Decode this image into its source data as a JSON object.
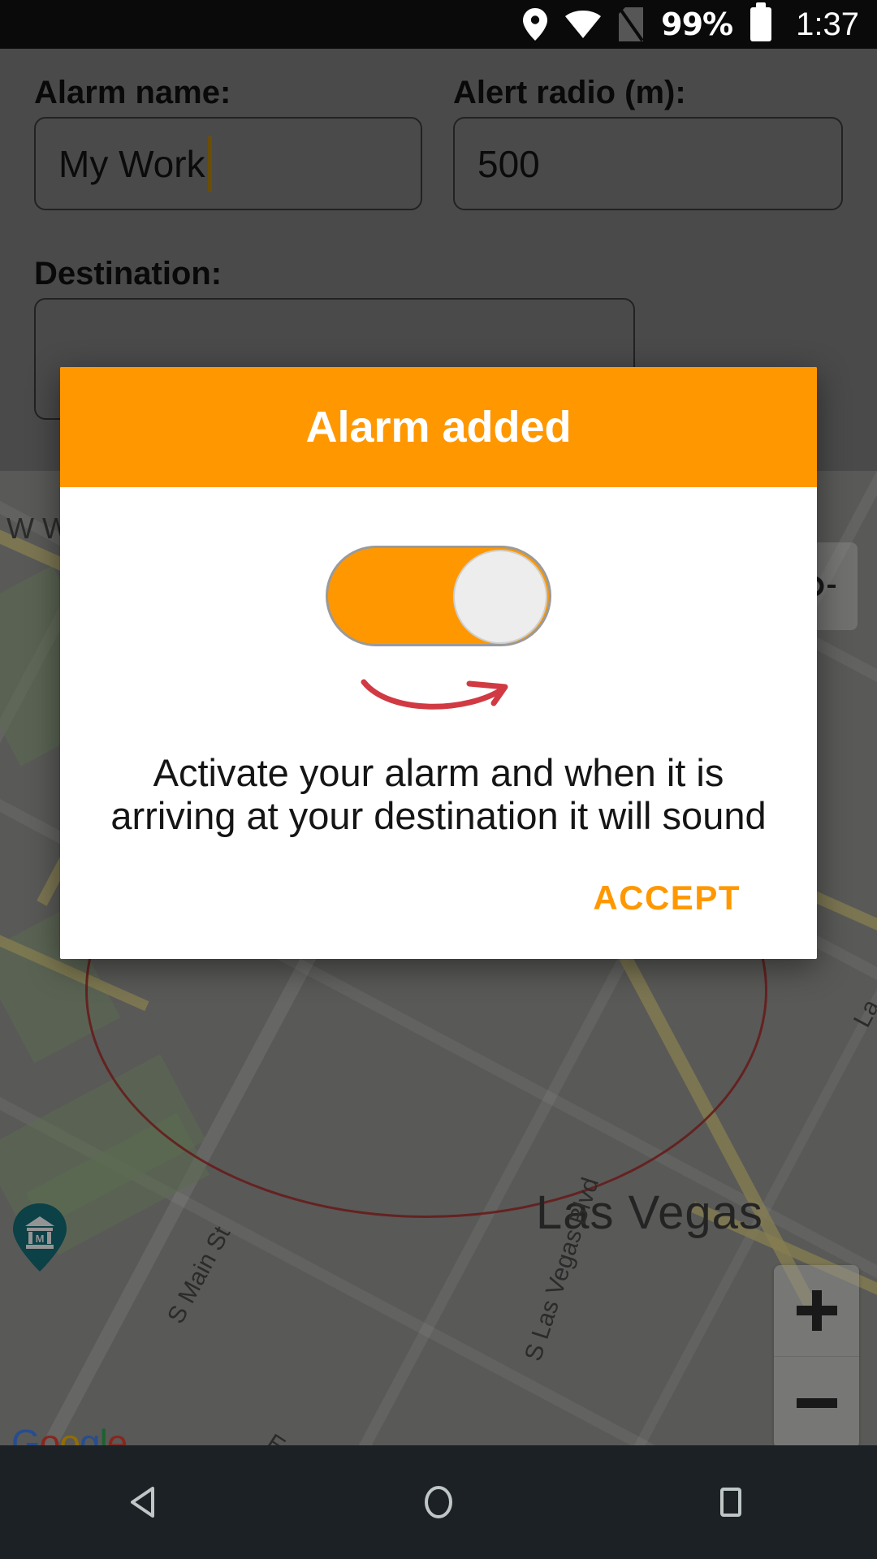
{
  "statusbar": {
    "location_icon": "location-pin-icon",
    "wifi_icon": "wifi-icon",
    "sim_icon": "no-sim-icon",
    "battery_percent": "99%",
    "battery_icon": "battery-full-icon",
    "time": "1:37"
  },
  "form": {
    "alarm_name_label": "Alarm name:",
    "alarm_name_value": "My Work",
    "alert_radio_label": "Alert radio (m):",
    "alert_radio_value": "500",
    "destination_label": "Destination:",
    "destination_value": "",
    "caret_color": "#b8860b"
  },
  "fab": {
    "name": "add-alarm-fab",
    "icon": "plus-icon",
    "color": "#3f6b3f"
  },
  "dialog": {
    "title": "Alarm added",
    "header_color": "#FF9800",
    "toggle": {
      "state": "on",
      "track_color": "#FF9800",
      "knob_color": "#ededed"
    },
    "arrow": {
      "icon": "curved-arrow-right-icon",
      "color": "#d13a43"
    },
    "message": "Activate your alarm and when it is arriving at your destination it will sound",
    "accept_label": "ACCEPT",
    "accept_color": "#FF9800"
  },
  "map": {
    "city_label": "Las Vegas",
    "streets": [
      "S Main St",
      "E Clark Ave",
      "S Las Vegas Blvd",
      "W W"
    ],
    "edge_label": "La",
    "attribution": "Google",
    "attribution_letters": [
      "G",
      "o",
      "o",
      "g",
      "l",
      "e"
    ],
    "museum_marker": "museum-pin-icon",
    "zoom_in_label": "+",
    "zoom_out_label": "−",
    "my_location_icon": "my-location-icon",
    "radius_circle_color": "#b02a2a"
  },
  "navbar": {
    "back": "back-nav-icon",
    "home": "home-nav-icon",
    "recents": "recents-nav-icon"
  }
}
